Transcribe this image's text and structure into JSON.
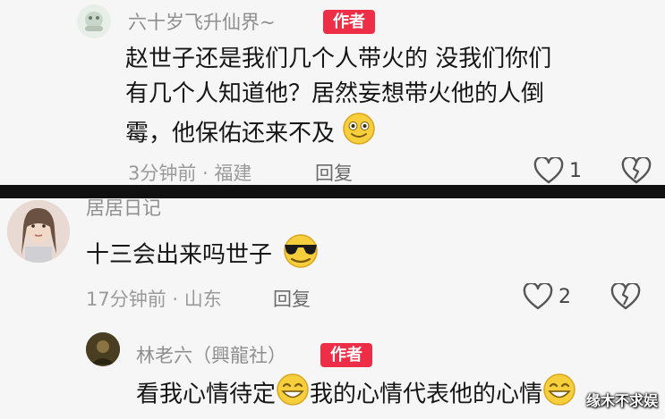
{
  "comments": [
    {
      "username": "六十岁飞升仙界~",
      "badge": "作者",
      "text_lines": [
        "赵世子还是我们几个人带火的 没我们你们",
        "有几个人知道他？居然妄想带火他的人倒",
        "霉，他保佑还来不及"
      ],
      "emoji_icon": "smile-emoji",
      "meta": "3分钟前 · 福建",
      "reply_label": "回复",
      "likes": "1"
    },
    {
      "username": "居居日记",
      "text": "十三会出来吗世子",
      "emoji_icon": "sunglasses-emoji",
      "meta": "17分钟前 · 山东",
      "reply_label": "回复",
      "likes": "2"
    },
    {
      "username": "林老六（興龍社）",
      "badge": "作者",
      "text_part1": "看我心情待定",
      "text_part2": "我的心情代表他的心情",
      "emoji_icon": "grin-emoji"
    }
  ],
  "watermark": "缘木不求娱",
  "colors": {
    "badge": "#ee2e46",
    "divider": "#101010",
    "panel": "#f6f6f6"
  }
}
